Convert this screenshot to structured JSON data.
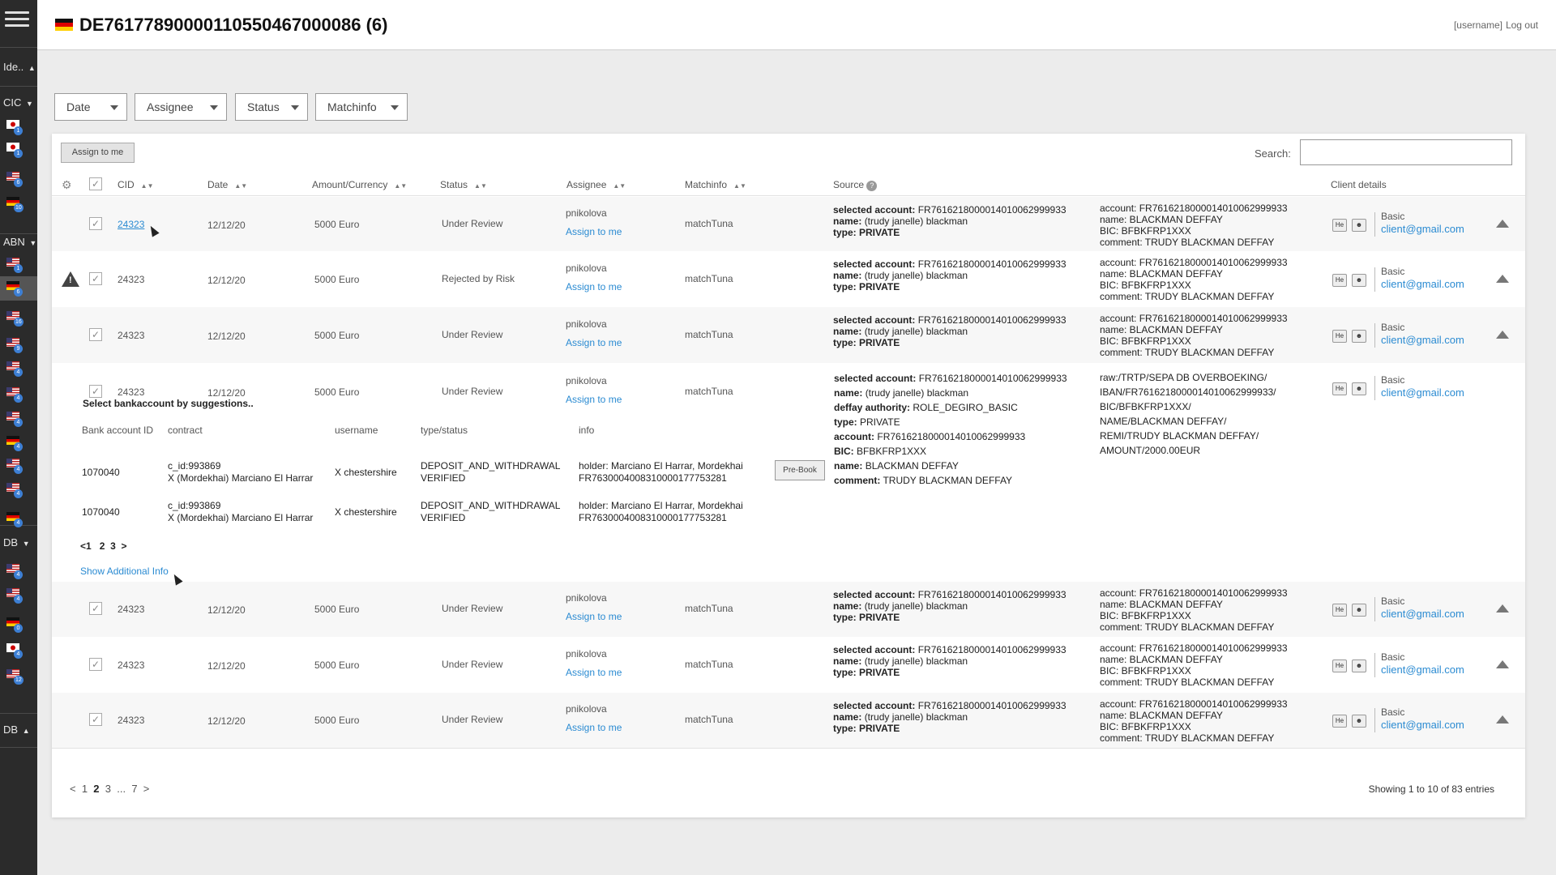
{
  "sidebar": {
    "groups": [
      {
        "label": "Ide..",
        "caret": "▲"
      },
      {
        "label": "CIC",
        "caret": "▼"
      },
      {
        "label": "ABN",
        "caret": "▼"
      },
      {
        "label": "DB",
        "caret": "▼"
      },
      {
        "label": "DB",
        "caret": "▲"
      }
    ],
    "flags": [
      {
        "country": "jp",
        "count": "1"
      },
      {
        "country": "jp",
        "count": "1"
      },
      {
        "country": "us",
        "count": "6"
      },
      {
        "country": "de",
        "count": "10"
      },
      {
        "country": "us",
        "count": "1"
      },
      {
        "country": "de",
        "count": "6"
      },
      {
        "country": "us",
        "count": "16"
      },
      {
        "country": "us",
        "count": "9"
      },
      {
        "country": "us",
        "count": "4"
      },
      {
        "country": "us",
        "count": "4"
      },
      {
        "country": "us",
        "count": "4"
      },
      {
        "country": "de",
        "count": "4"
      },
      {
        "country": "us",
        "count": "4"
      },
      {
        "country": "us",
        "count": "4"
      },
      {
        "country": "de",
        "count": "4"
      },
      {
        "country": "us",
        "count": "4"
      },
      {
        "country": "us",
        "count": "4"
      },
      {
        "country": "de",
        "count": "0"
      },
      {
        "country": "jp",
        "count": "4"
      },
      {
        "country": "us",
        "count": "12"
      }
    ]
  },
  "header": {
    "title": "DE76177890000110550467000 86 (6)",
    "title_full": "DE76177890000110550467 00086 (6)",
    "user": "[username]",
    "logout": "Log out"
  },
  "filters": [
    "Date",
    "Assignee",
    "Status",
    "Matchinfo"
  ],
  "toolbar": {
    "assign_label": "Assign to me",
    "search_label": "Search:",
    "search_value": ""
  },
  "columns": {
    "cid": "CID",
    "date": "Date",
    "amount": "Amount/Currency",
    "status": "Status",
    "assignee": "Assignee",
    "matchinfo": "Matchinfo",
    "source": "Source",
    "client": "Client details"
  },
  "rows": [
    {
      "cid": "24323",
      "date": "12/12/20",
      "amount": "5000 Euro",
      "status": "Under Review",
      "assignee": "pnikolova",
      "assign": "Assign to me",
      "match": "matchTuna",
      "src1": "selected account:",
      "src1v": "FR7616218000014010062999933",
      "src2": "name:",
      "src2v": "(trudy janelle) blackman",
      "src3": "type: PRIVATE",
      "acc": "account: FR7616218000014010062999933",
      "accname": "name: BLACKMAN DEFFAY",
      "bic": "BIC: BFBKFRP1XXX",
      "comment": "comment: TRUDY BLACKMAN DEFFAY",
      "tier": "Basic",
      "email": "client@gmail.com",
      "he": "He"
    },
    {
      "cid": "24323",
      "date": "12/12/20",
      "amount": "5000 Euro",
      "status": "Rejected by Risk",
      "assignee": "pnikolova",
      "assign": "Assign to me",
      "match": "matchTuna",
      "src1": "selected account:",
      "src1v": "FR7616218000014010062999933",
      "src2": "name:",
      "src2v": "(trudy janelle) blackman",
      "src3": "type: PRIVATE",
      "acc": "account: FR7616218000014010062999933",
      "accname": "name: BLACKMAN DEFFAY",
      "bic": "BIC: BFBKFRP1XXX",
      "comment": "comment: TRUDY BLACKMAN DEFFAY",
      "tier": "Basic",
      "email": "client@gmail.com",
      "he": "He"
    },
    {
      "cid": "24323",
      "date": "12/12/20",
      "amount": "5000 Euro",
      "status": "Under Review",
      "assignee": "pnikolova",
      "assign": "Assign to me",
      "match": "matchTuna",
      "src1": "selected account:",
      "src1v": "FR7616218000014010062999933",
      "src2": "name:",
      "src2v": "(trudy janelle) blackman",
      "src3": "type: PRIVATE",
      "acc": "account: FR7616218000014010062999933",
      "accname": "name: BLACKMAN DEFFAY",
      "bic": "BIC: BFBKFRP1XXX",
      "comment": "comment: TRUDY BLACKMAN DEFFAY",
      "tier": "Basic",
      "email": "client@gmail.com",
      "he": "He"
    },
    {
      "cid": "24323",
      "date": "12/12/20",
      "amount": "5000 Euro",
      "status": "Under Review",
      "assignee": "pnikolova",
      "assign": "Assign to me",
      "match": "matchTuna",
      "tier": "Basic",
      "email": "client@gmail.com",
      "he": "He"
    },
    {
      "cid": "24323",
      "date": "12/12/20",
      "amount": "5000 Euro",
      "status": "Under Review",
      "assignee": "pnikolova",
      "assign": "Assign to me",
      "match": "matchTuna",
      "src1": "selected account:",
      "src1v": "FR7616218000014010062999933",
      "src2": "name:",
      "src2v": "(trudy janelle) blackman",
      "src3": "type: PRIVATE",
      "acc": "account: FR7616218000014010062999933",
      "accname": "name: BLACKMAN DEFFAY",
      "bic": "BIC: BFBKFRP1XXX",
      "comment": "comment: TRUDY BLACKMAN DEFFAY",
      "tier": "Basic",
      "email": "client@gmail.com",
      "he": "He"
    },
    {
      "cid": "24323",
      "date": "12/12/20",
      "amount": "5000 Euro",
      "status": "Under Review",
      "assignee": "pnikolova",
      "assign": "Assign to me",
      "match": "matchTuna",
      "src1": "selected account:",
      "src1v": "FR7616218000014010062999933",
      "src2": "name:",
      "src2v": "(trudy janelle) blackman",
      "src3": "type: PRIVATE",
      "acc": "account: FR7616218000014010062999933",
      "accname": "name: BLACKMAN DEFFAY",
      "bic": "BIC: BFBKFRP1XXX",
      "comment": "comment: TRUDY BLACKMAN DEFFAY",
      "tier": "Basic",
      "email": "client@gmail.com",
      "he": "He"
    },
    {
      "cid": "24323",
      "date": "12/12/20",
      "amount": "5000 Euro",
      "status": "Under Review",
      "assignee": "pnikolova",
      "assign": "Assign to me",
      "match": "matchTuna",
      "src1": "selected account:",
      "src1v": "FR7616218000014010062999933",
      "src2": "name:",
      "src2v": "(trudy janelle) blackman",
      "src3": "type: PRIVATE",
      "acc": "account: FR7616218000014010062999933",
      "accname": "name: BLACKMAN DEFFAY",
      "bic": "BIC: BFBKFRP1XXX",
      "comment": "comment: TRUDY BLACKMAN DEFFAY",
      "tier": "Basic",
      "email": "client@gmail.com",
      "he": "He"
    }
  ],
  "expanded": {
    "title": "Select bankaccount by suggestions..",
    "headers": [
      "Bank account ID",
      "contract",
      "username",
      "type/status",
      "info"
    ],
    "items": [
      {
        "id": "1070040",
        "contract1": "c_id:993869",
        "contract2": "X (Mordekhai) Marciano El Harrar",
        "username": "X chestershire",
        "type1": "DEPOSIT_AND_WITHDRAWAL",
        "type2": "VERIFIED",
        "info1": "holder: Marciano El Harrar, Mordekhai",
        "info2": "FR7630004008310000177753281",
        "prebook": "Pre-Book"
      },
      {
        "id": "1070040",
        "contract1": "c_id:993869",
        "contract2": "X (Mordekhai) Marciano El Harrar",
        "username": "X chestershire",
        "type1": "DEPOSIT_AND_WITHDRAWAL",
        "type2": "VERIFIED",
        "info1": "holder: Marciano El Harrar, Mordekhai",
        "info2": "FR7630004008310000177753281"
      }
    ],
    "pager": {
      "prev": "<",
      "current": "1",
      "pages": [
        "2",
        "3"
      ],
      "next": ">"
    },
    "show_more": "Show Additional Info",
    "source": [
      {
        "label": "selected account:",
        "value": "FR7616218000014010062999933"
      },
      {
        "label": "name:",
        "value": "(trudy janelle) blackman"
      },
      {
        "label": "deffay authority:",
        "value": "ROLE_DEGIRO_BASIC"
      },
      {
        "label": "type:",
        "value": "PRIVATE"
      },
      {
        "label": "account:",
        "value": "FR7616218000014010062999933"
      },
      {
        "label": "BIC:",
        "value": "BFBKFRP1XXX"
      },
      {
        "label": "name:",
        "value": "BLACKMAN DEFFAY"
      },
      {
        "label": "comment:",
        "value": "TRUDY BLACKMAN DEFFAY"
      }
    ],
    "raw": [
      "raw:/TRTP/SEPA DB OVERBOEKING/",
      "IBAN/FR7616218000014010062999933/",
      "BIC/BFBKFRP1XXX/",
      "NAME/BLACKMAN DEFFAY/",
      "REMI/TRUDY BLACKMAN DEFFAY/",
      "AMOUNT/2000.00EUR"
    ]
  },
  "pagination": {
    "prev": "<",
    "pages": [
      "1",
      "2",
      "3",
      "...",
      "7"
    ],
    "next": ">",
    "current": "2"
  },
  "entries_text": "Showing 1 to 10 of 83 entries"
}
